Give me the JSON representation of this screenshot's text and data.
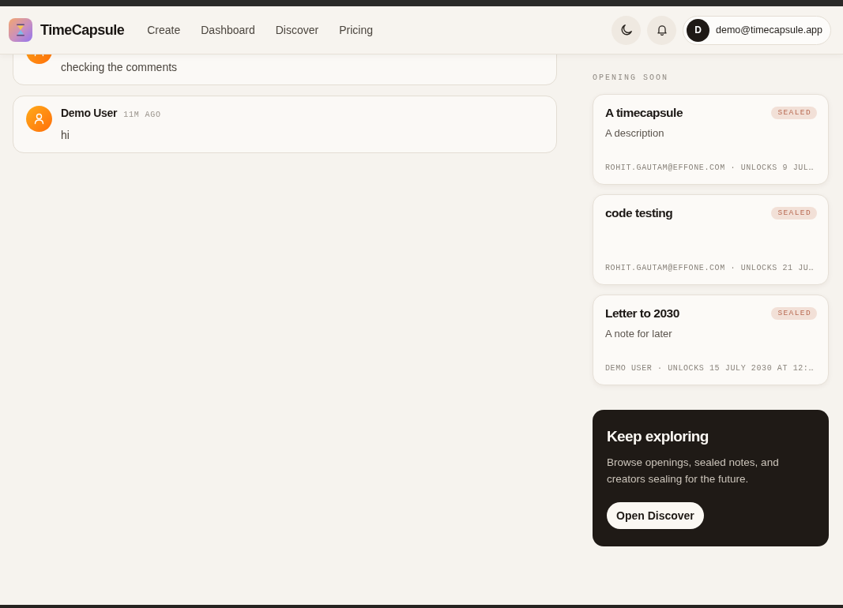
{
  "header": {
    "brand": "TimeCapsule",
    "nav": [
      {
        "label": "Create"
      },
      {
        "label": "Dashboard"
      },
      {
        "label": "Discover"
      },
      {
        "label": "Pricing"
      }
    ],
    "user": {
      "initial": "D",
      "email": "demo@timecapsule.app"
    }
  },
  "comments": [
    {
      "text": "checking the comments"
    },
    {
      "author": "Demo User",
      "time": "11M AGO",
      "text": "hi"
    }
  ],
  "sidebar": {
    "heading": "OPENING SOON",
    "capsules": [
      {
        "title": "A timecapsule",
        "status": "SEALED",
        "description": "A description",
        "meta": "ROHIT.GAUTAM@EFFONE.COM · UNLOCKS 9 JUL…"
      },
      {
        "title": "code testing",
        "status": "SEALED",
        "meta": "ROHIT.GAUTAM@EFFONE.COM · UNLOCKS 21 JU…"
      },
      {
        "title": "Letter to 2030",
        "status": "SEALED",
        "description": "A note for later",
        "meta": "DEMO USER · UNLOCKS 15 JULY 2030 AT 12:…"
      }
    ],
    "promo": {
      "title": "Keep exploring",
      "text": "Browse openings, sealed notes, and creators sealing for the future.",
      "button": "Open Discover"
    }
  }
}
